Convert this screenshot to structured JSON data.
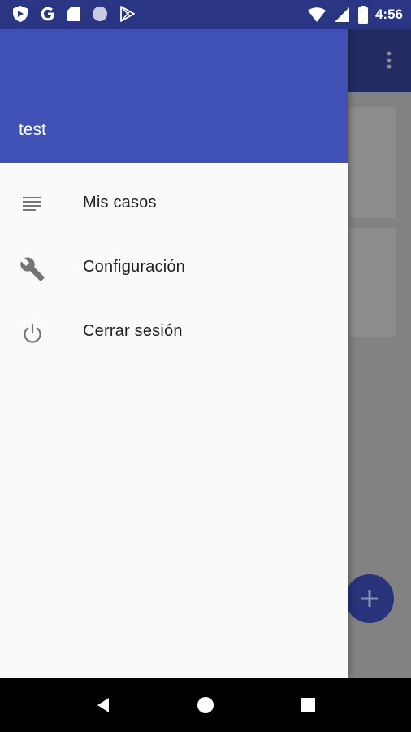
{
  "status_bar": {
    "time": "4:56",
    "left_icons": [
      "shield-icon",
      "google-icon",
      "sd-card-icon",
      "circle-icon",
      "play-store-icon"
    ],
    "right_icons": [
      "wifi-icon",
      "signal-icon",
      "battery-icon"
    ]
  },
  "drawer": {
    "user_name": "test",
    "items": [
      {
        "label": "Mis casos",
        "icon": "list-icon"
      },
      {
        "label": "Configuración",
        "icon": "wrench-icon"
      },
      {
        "label": "Cerrar sesión",
        "icon": "power-icon"
      }
    ]
  },
  "background_app": {
    "fab_icon": "plus-icon",
    "overflow_icon": "more-vert-icon"
  },
  "nav_bar": {
    "buttons": [
      "back-icon",
      "home-icon",
      "recents-icon"
    ]
  },
  "colors": {
    "primary": "#3f51b5",
    "primary_dark": "#2a3684",
    "icon_gray": "#757575"
  }
}
